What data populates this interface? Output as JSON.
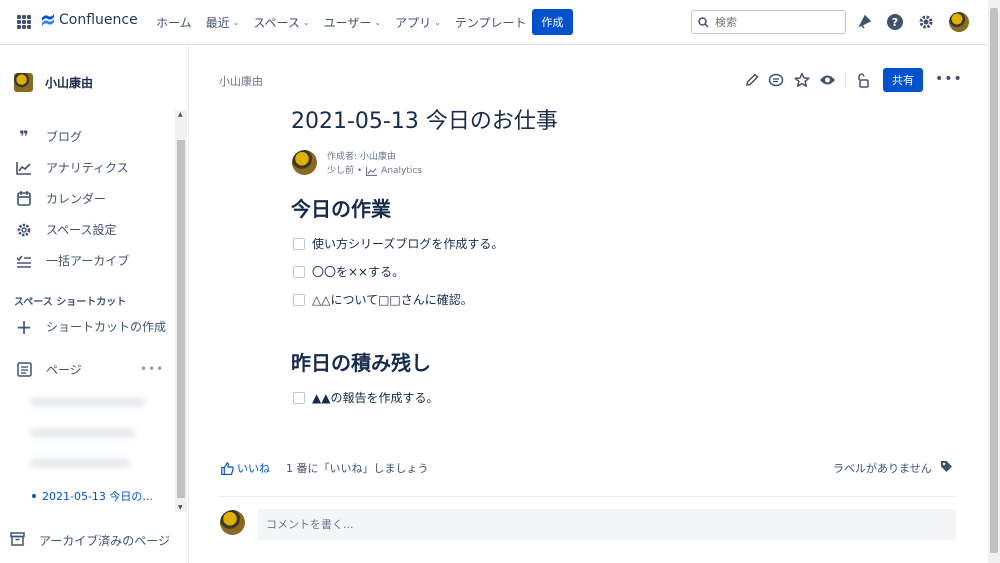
{
  "topbar": {
    "app_name": "Confluence",
    "nav": [
      {
        "label": "ホーム",
        "dropdown": false
      },
      {
        "label": "最近",
        "dropdown": true
      },
      {
        "label": "スペース",
        "dropdown": true
      },
      {
        "label": "ユーザー",
        "dropdown": true
      },
      {
        "label": "アプリ",
        "dropdown": true
      },
      {
        "label": "テンプレート",
        "dropdown": false
      }
    ],
    "create_label": "作成",
    "search_placeholder": "検索",
    "accent": "#0052cc"
  },
  "sidebar": {
    "space_name": "小山康由",
    "items": [
      {
        "label": "ブログ",
        "icon": "quote-icon"
      },
      {
        "label": "アナリティクス",
        "icon": "chart-line-icon"
      },
      {
        "label": "カレンダー",
        "icon": "calendar-icon"
      },
      {
        "label": "スペース設定",
        "icon": "gear-icon"
      },
      {
        "label": "一括アーカイブ",
        "icon": "bulk-archive-icon"
      }
    ],
    "shortcuts_heading": "スペース ショートカット",
    "add_shortcut_label": "ショートカットの作成",
    "pages_label": "ページ",
    "active_page": "2021-05-13 今日の...",
    "archive_label": "アーカイブ済みのページ"
  },
  "page": {
    "breadcrumb": "小山康由",
    "share_label": "共有",
    "title": "2021-05-13 今日のお仕事",
    "author_line": "作成者: 小山康由",
    "time_line": "少し前 •",
    "analytics_label": "Analytics",
    "sections": [
      {
        "heading": "今日の作業",
        "tasks": [
          "使い方シリーズブログを作成する。",
          "〇〇を××する。",
          "△△について□□さんに確認。"
        ]
      },
      {
        "heading": "昨日の積み残し",
        "tasks": [
          "▲▲の報告を作成する。"
        ]
      }
    ],
    "like_label": "いいね",
    "like_prompt": "1 番に「いいね」しましょう",
    "labels_text": "ラベルがありません",
    "comment_placeholder": "コメントを書く..."
  }
}
